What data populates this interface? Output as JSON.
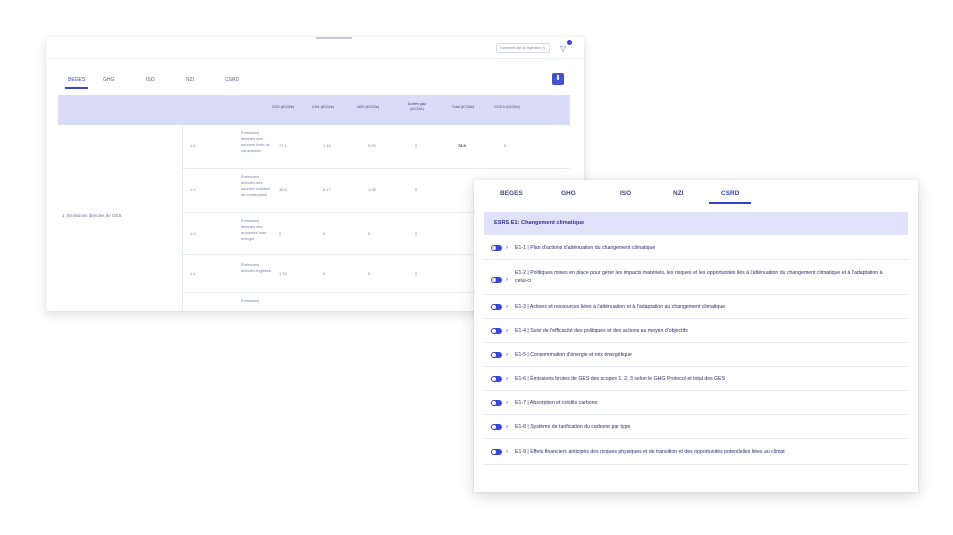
{
  "back_window": {
    "period_select": "Sommes de la Injection ∨",
    "filter_icon": "filter-icon",
    "tabs": [
      "BEGES",
      "GHG",
      "ISO",
      "NZI",
      "CSRD"
    ],
    "active_tab": "BEGES",
    "download_icon": "download-icon",
    "table": {
      "headers": [
        "CO2 (tCO2e)",
        "CH4 (tCO2e)",
        "N2O (tCO2e)",
        "Autres gaz (tCO2e)",
        "Total (tCO2e)",
        "CO2 b (tCO2e)"
      ],
      "group_label": "1. Émissions directes de GES",
      "rows": [
        {
          "code": "1.1",
          "desc": "Émissions directes des sources fixes de combustion",
          "values": [
            "77.1",
            "1.16",
            "0.43",
            "0",
            "78.5",
            "0"
          ]
        },
        {
          "code": "1.2",
          "desc": "Émissions directes des sources mobiles de combustion",
          "values": [
            "30.5",
            "0.17",
            "1.09",
            "0",
            "",
            ""
          ]
        },
        {
          "code": "1.3",
          "desc": "Émissions directes des procédés hors énergie",
          "values": [
            "0",
            "0",
            "0",
            "0",
            "",
            ""
          ]
        },
        {
          "code": "1.4",
          "desc": "Émissions directes fugitives",
          "values": [
            "1.74",
            "0",
            "0",
            "0",
            "",
            ""
          ]
        },
        {
          "code": "",
          "desc": "Émissions",
          "values": [
            "",
            "",
            "",
            "",
            "",
            ""
          ]
        }
      ]
    }
  },
  "front_window": {
    "tabs": [
      "BEGES",
      "GHG",
      "ISO",
      "NZI",
      "CSRD"
    ],
    "active_tab": "CSRD",
    "section_title": "ESRS E1: Changement climatique",
    "items": [
      {
        "label": "E1-1 | Plan d'actions d'atténuation du changement climatique"
      },
      {
        "label": "E1-2 | Politiques mises en place pour gérer les impacts matériels, les risques et les opportunités liés à l'atténuation du changement climatique et à l'adaptation à celui-ci"
      },
      {
        "label": "E1-3 | Actions et ressources liées à l'atténuation et à l'adaptation au changement climatique"
      },
      {
        "label": "E1-4 | Suivi de l'efficacité des politiques et des actions au moyen d'objectifs"
      },
      {
        "label": "E1-5 | Consommation d'énergie et mix énergétique"
      },
      {
        "label": "E1-6 | Émissions brutes de GES des scopes 1, 2, 3 selon le GHG Protocol et total des GES"
      },
      {
        "label": "E1-7 | Absorption et crédits carbone"
      },
      {
        "label": "E1-8 | Système de tarification du carbone par type"
      },
      {
        "label": "E1-9 | Effets financiers anticipés des risques physiques et de transition et des opportunités potentielles liées au climat"
      }
    ],
    "chevron_icon": "chevron-right-icon",
    "toggle_icon": "toggle-on-icon"
  }
}
